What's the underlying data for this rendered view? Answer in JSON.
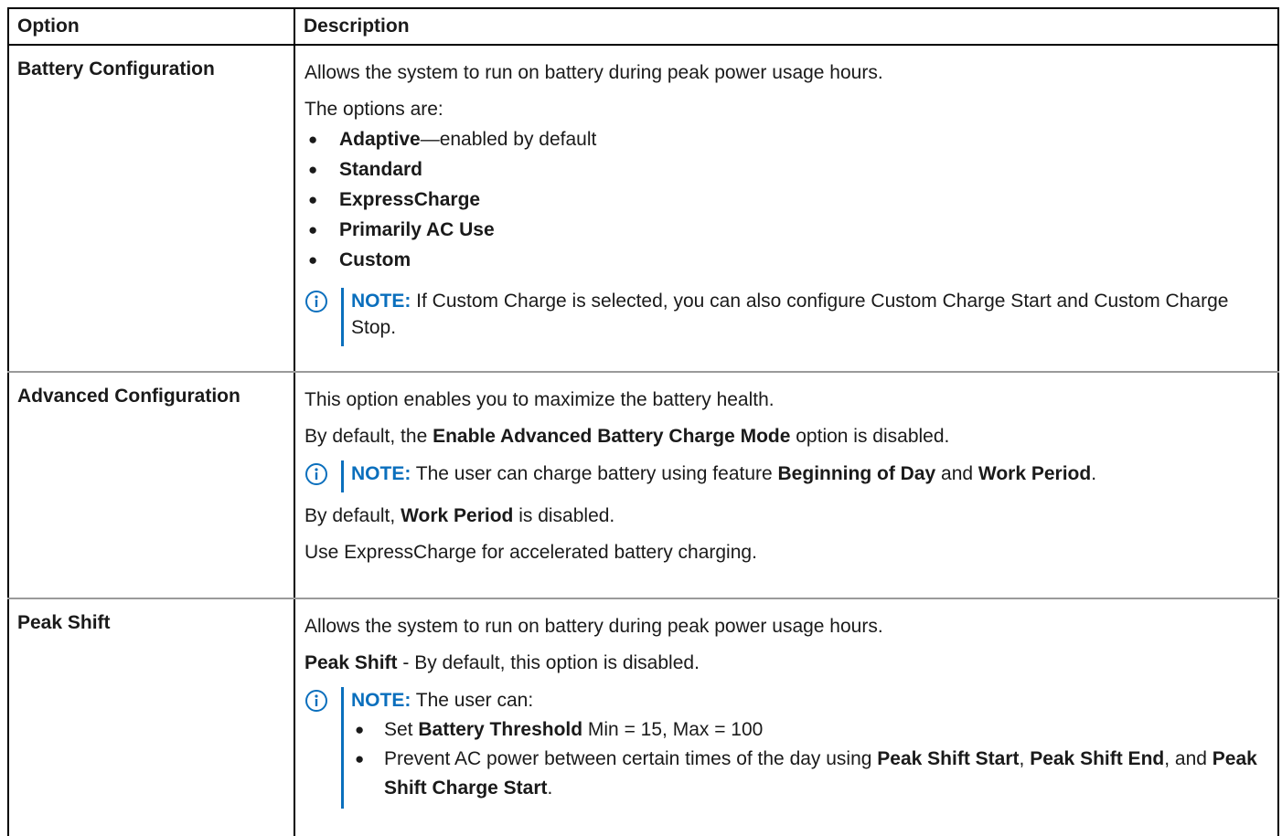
{
  "table": {
    "headers": {
      "option": "Option",
      "description": "Description"
    },
    "battery": {
      "option": "Battery Configuration",
      "line1": "Allows the system to run on battery during peak power usage hours.",
      "line2": "The options are:",
      "bullets": [
        "Adaptive",
        "Standard",
        "ExpressCharge",
        "Primarily AC Use",
        "Custom"
      ],
      "adaptive_suffix": "—enabled by default",
      "note_label": "NOTE:",
      "note_text": " If Custom Charge is selected, you can also configure Custom Charge Start and Custom Charge Stop."
    },
    "advanced": {
      "option": "Advanced Configuration",
      "line1": "This option enables you to maximize the battery health.",
      "line2_pre": "By default, the ",
      "line2_bold": "Enable Advanced Battery Charge Mode",
      "line2_post": " option is disabled.",
      "note_label": "NOTE:",
      "note_pre": " The user can charge battery using feature ",
      "note_bold1": "Beginning of Day",
      "note_mid": " and ",
      "note_bold2": "Work Period",
      "note_post": ".",
      "line3_pre": "By default, ",
      "line3_bold": "Work Period",
      "line3_post": " is disabled.",
      "line4": "Use ExpressCharge for accelerated battery charging."
    },
    "peak": {
      "option": "Peak Shift",
      "line1": "Allows the system to run on battery during peak power usage hours.",
      "line2_bold": "Peak Shift",
      "line2_post": " - By default, this option is disabled.",
      "note_label": "NOTE:",
      "note_text": " The user can:",
      "b1_pre": "Set ",
      "b1_bold": "Battery Threshold",
      "b1_post": " Min = 15, Max = 100",
      "b2_pre": "Prevent AC power between certain times of the day using ",
      "b2_bold1": "Peak Shift Start",
      "b2_sep1": ", ",
      "b2_bold2": "Peak Shift End",
      "b2_sep2": ", and ",
      "b2_bold3": "Peak Shift Charge Start",
      "b2_post": "."
    }
  },
  "icons": {
    "note": "info-circle-icon",
    "bullet": "bullet-dot-icon"
  },
  "colors": {
    "note_accent": "#0a6fbd",
    "row_separator": "#9a9a9a",
    "border": "#000000"
  }
}
